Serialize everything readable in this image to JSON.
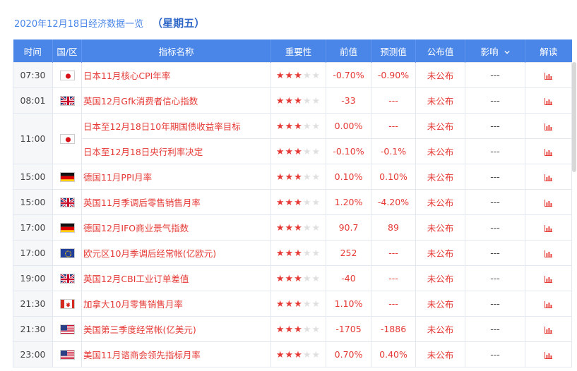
{
  "header": {
    "date_title": "2020年12月18日经济数据一览",
    "weekday": "（星期五）"
  },
  "table": {
    "columns": [
      "时间",
      "国/区",
      "指标名称",
      "重要性",
      "前值",
      "预测值",
      "公布值",
      "影响",
      "解读"
    ],
    "rows": [
      {
        "time": "07:30",
        "country": "japan",
        "name": "日本11月核心CPI年率",
        "stars": 3,
        "prev": "-0.70%",
        "forecast": "-0.90%",
        "actual": "未公布",
        "impact": "---"
      },
      {
        "time": "08:01",
        "country": "uk",
        "name": "英国12月Gfk消费者信心指数",
        "stars": 3,
        "prev": "-33",
        "forecast": "---",
        "actual": "未公布",
        "impact": "---"
      },
      {
        "time": "11:00",
        "country": "japan",
        "name": "日本至12月18日10年期国债收益率目标",
        "stars": 3,
        "prev": "0.00%",
        "forecast": "---",
        "actual": "未公布",
        "impact": "---"
      },
      {
        "time": "",
        "country": "",
        "name": "日本至12月18日央行利率决定",
        "stars": 3,
        "prev": "-0.10%",
        "forecast": "-0.1%",
        "actual": "未公布",
        "impact": "---"
      },
      {
        "time": "15:00",
        "country": "germany",
        "name": "德国11月PPI月率",
        "stars": 3,
        "prev": "0.10%",
        "forecast": "0.10%",
        "actual": "未公布",
        "impact": "---"
      },
      {
        "time": "15:00",
        "country": "uk",
        "name": "英国11月季调后零售销售月率",
        "stars": 3,
        "prev": "1.20%",
        "forecast": "-4.20%",
        "actual": "未公布",
        "impact": "---"
      },
      {
        "time": "17:00",
        "country": "germany",
        "name": "德国12月IFO商业景气指数",
        "stars": 3,
        "prev": "90.7",
        "forecast": "89",
        "actual": "未公布",
        "impact": "---"
      },
      {
        "time": "17:00",
        "country": "eu",
        "name": "欧元区10月季调后经常帐(亿欧元)",
        "stars": 3,
        "prev": "252",
        "forecast": "---",
        "actual": "未公布",
        "impact": "---"
      },
      {
        "time": "19:00",
        "country": "uk",
        "name": "英国12月CBI工业订单差值",
        "stars": 3,
        "prev": "-40",
        "forecast": "---",
        "actual": "未公布",
        "impact": "---"
      },
      {
        "time": "21:30",
        "country": "canada",
        "name": "加拿大10月零售销售月率",
        "stars": 3,
        "prev": "1.10%",
        "forecast": "---",
        "actual": "未公布",
        "impact": "---"
      },
      {
        "time": "21:30",
        "country": "us",
        "name": "美国第三季度经常帐(亿美元)",
        "stars": 3,
        "prev": "-1705",
        "forecast": "-1886",
        "actual": "未公布",
        "impact": "---"
      },
      {
        "time": "23:00",
        "country": "us",
        "name": "美国11月谘商会领先指标月率",
        "stars": 3,
        "prev": "0.70%",
        "forecast": "0.40%",
        "actual": "未公布",
        "impact": "---"
      }
    ]
  },
  "colors": {
    "header_bg": "#4a86e8",
    "accent_red": "#e53935"
  }
}
